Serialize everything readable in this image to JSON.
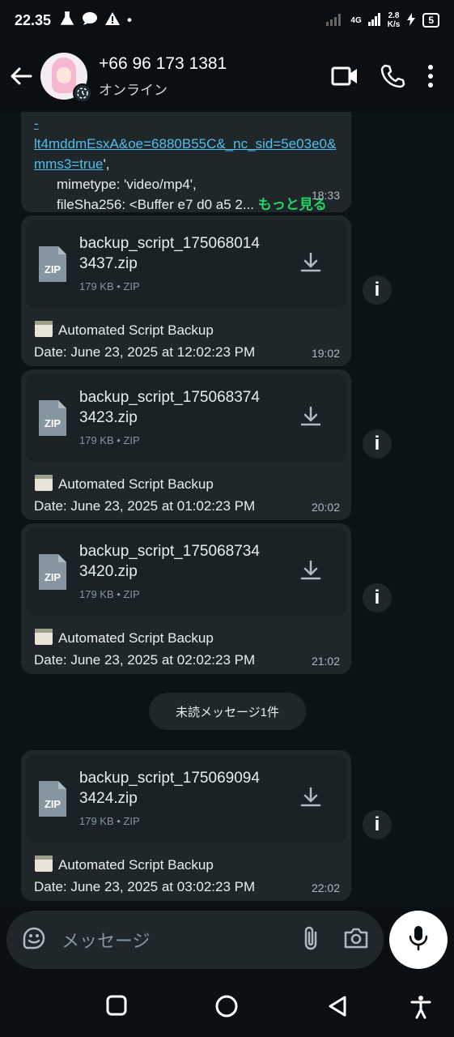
{
  "status_bar": {
    "time": "22.35",
    "network": "4G",
    "speed_value": "2.8",
    "speed_unit": "K/s",
    "battery": "5"
  },
  "header": {
    "contact_name": "+66 96 173 1381",
    "contact_status": "オンライン"
  },
  "top_message": {
    "link_line1": "-lt4mddmEsxA&oe=6880B55C&_nc_sid=5e03e0&",
    "link_line2": "mms3=true",
    "link_suffix": "',",
    "line3": "mimetype: 'video/mp4',",
    "line4": "fileSha256: <Buffer e7 d0 a5 2...",
    "more": "もっと見る",
    "time": "18:33"
  },
  "file_messages": [
    {
      "filename_line1": "backup_script_175068014",
      "filename_line2": "3437.zip",
      "meta": "179 KB • ZIP",
      "caption_title": "Automated Script Backup",
      "caption_date": "Date: June 23, 2025 at 12:02:23 PM",
      "time": "19:02",
      "icon_label": "ZIP"
    },
    {
      "filename_line1": "backup_script_175068374",
      "filename_line2": "3423.zip",
      "meta": "179 KB • ZIP",
      "caption_title": "Automated Script Backup",
      "caption_date": "Date: June 23, 2025 at 01:02:23 PM",
      "time": "20:02",
      "icon_label": "ZIP"
    },
    {
      "filename_line1": "backup_script_175068734",
      "filename_line2": "3420.zip",
      "meta": "179 KB • ZIP",
      "caption_title": "Automated Script Backup",
      "caption_date": "Date: June 23, 2025 at 02:02:23 PM",
      "time": "21:02",
      "icon_label": "ZIP"
    },
    {
      "filename_line1": "backup_script_175069094",
      "filename_line2": "3424.zip",
      "meta": "179 KB • ZIP",
      "caption_title": "Automated Script Backup",
      "caption_date": "Date: June 23, 2025 at 03:02:23 PM",
      "time": "22:02",
      "icon_label": "ZIP"
    }
  ],
  "unread_divider": "未読メッセージ1件",
  "info_label": "i",
  "input": {
    "placeholder": "メッセージ"
  },
  "colors": {
    "background": "#0b0f11",
    "bubble": "#1f272a",
    "link": "#53bdeb",
    "accent_green": "#25d366"
  }
}
